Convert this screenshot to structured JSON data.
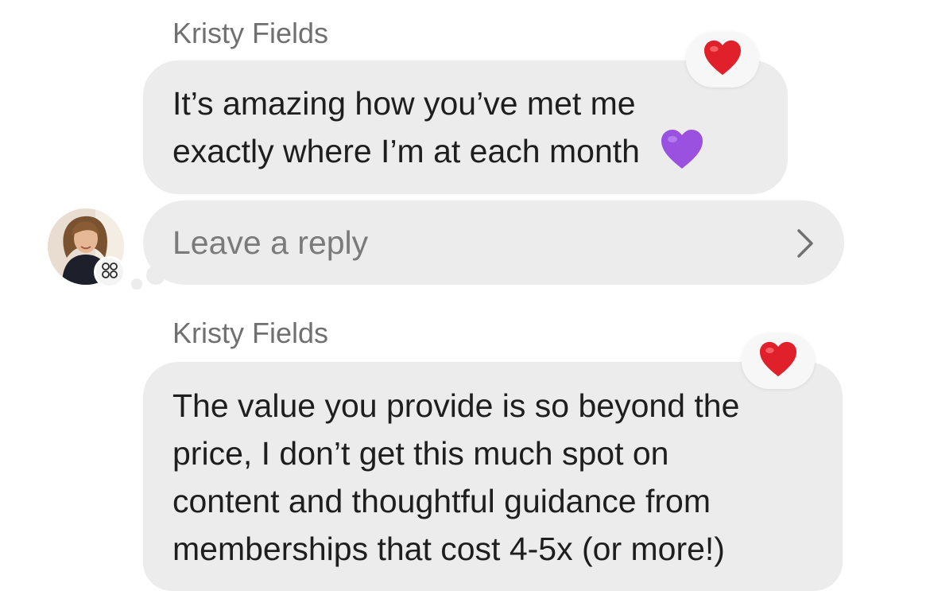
{
  "messages": [
    {
      "sender": "Kristy Fields",
      "text_lines": [
        "It’s amazing how you’ve met me",
        "exactly where I’m at each month"
      ],
      "inline_emoji": "purple-heart",
      "reaction": "red-heart"
    },
    {
      "sender": "Kristy Fields",
      "text_lines": [
        "The value you provide is so beyond the",
        "price, I don’t get this much spot on",
        "content and thoughtful guidance from",
        "memberships that cost 4-5x (or more!)"
      ],
      "reaction": "red-heart"
    }
  ],
  "reply": {
    "placeholder": "Leave a reply",
    "icon": "chevron-right-icon"
  },
  "avatar": {
    "badge_icon": "clover-icon"
  },
  "colors": {
    "bubble": "#ececec",
    "sender_text": "#707070",
    "placeholder_text": "#7a7a7a",
    "heart_red": "#e0202b",
    "heart_purple": "#9b51e0"
  }
}
